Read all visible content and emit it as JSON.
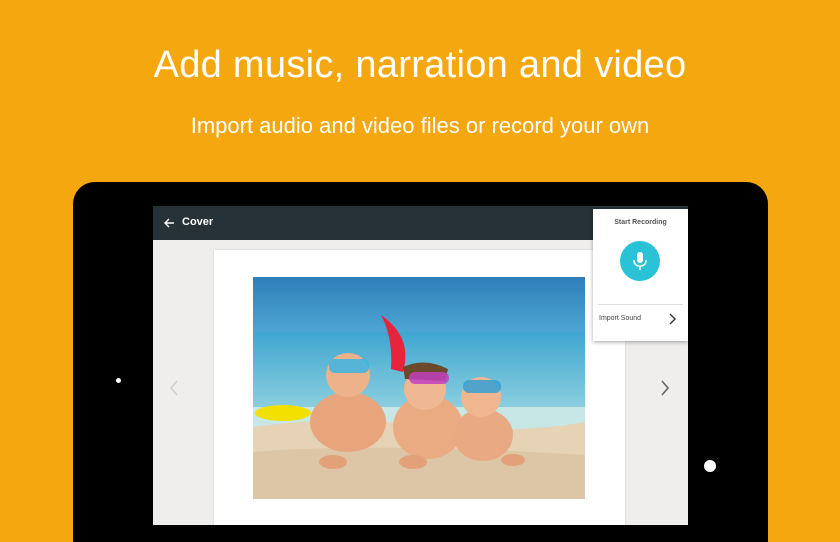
{
  "promo": {
    "headline": "Add music, narration and video",
    "subline": "Import audio and video files or record your own",
    "background_color": "#F4A70F"
  },
  "app": {
    "toolbar_title": "Cover",
    "toolbar_color": "#263238",
    "back_icon": "arrow-back-icon",
    "prev_icon": "chevron-left-icon",
    "next_icon": "chevron-right-icon"
  },
  "popup": {
    "title": "Start Recording",
    "mic_icon": "microphone-icon",
    "accent_color": "#2AC2D7",
    "import_label": "Import Sound",
    "import_icon": "chevron-right-icon"
  }
}
